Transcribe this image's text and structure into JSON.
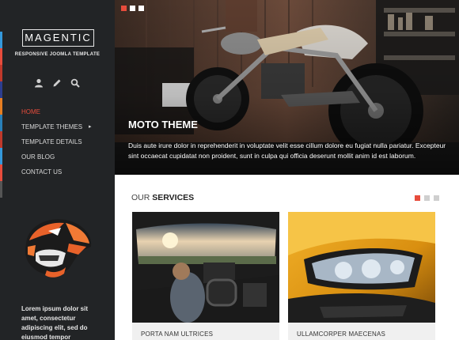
{
  "brand": {
    "name": "MAGENTIC",
    "tagline": "RESPONSIVE JOOMLA TEMPLATE"
  },
  "toolbar": {
    "icons": [
      "user-icon",
      "pencil-icon",
      "search-icon"
    ]
  },
  "nav": {
    "items": [
      {
        "label": "HOME",
        "active": true
      },
      {
        "label": "TEMPLATE THEMES",
        "has_submenu": true
      },
      {
        "label": "TEMPLATE DETAILS"
      },
      {
        "label": "OUR BLOG"
      },
      {
        "label": "CONTACT US"
      }
    ]
  },
  "sidebar": {
    "text": "Lorem ipsum dolor sit amet, consectetur adipiscing elit, sed do eiusmod tempor",
    "strip_colors": [
      "#3498db",
      "#e74c3c",
      "#c0392b",
      "#2c3e8f",
      "#e67e22",
      "#2980b9",
      "#c0392b",
      "#3498db",
      "#e74c3c",
      "#555555"
    ]
  },
  "hero": {
    "title": "MOTO THEME",
    "text": "Duis aute irure dolor in reprehenderit in voluptate velit esse cillum dolore eu fugiat nulla pariatur. Excepteur sint occaecat cupidatat non proident, sunt in culpa qui officia deserunt mollit anim id est laborum.",
    "slide_count": 3,
    "active_slide": 1
  },
  "services": {
    "heading_light": "OUR",
    "heading_bold": "SERVICES",
    "cards": [
      {
        "label": "PORTA NAM ULTRICES"
      },
      {
        "label": "ULLAMCORPER MAECENAS"
      }
    ],
    "page_count": 3,
    "active_page": 1
  },
  "colors": {
    "accent": "#e74c3c",
    "sidebar_bg": "#222426"
  }
}
